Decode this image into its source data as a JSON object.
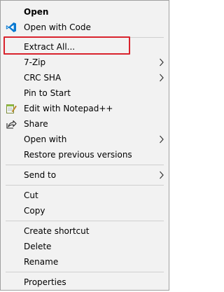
{
  "menu": {
    "items": [
      {
        "key": "open",
        "label": "Open",
        "bold": true
      },
      {
        "key": "open_code",
        "label": "Open with Code",
        "icon": "vscode-icon"
      },
      {
        "key": "extract",
        "label": "Extract All...",
        "highlighted": true
      },
      {
        "key": "zip",
        "label": "7-Zip",
        "submenu": true
      },
      {
        "key": "crc",
        "label": "CRC SHA",
        "submenu": true
      },
      {
        "key": "pin",
        "label": "Pin to Start"
      },
      {
        "key": "notepad",
        "label": "Edit with Notepad++",
        "icon": "notepad-plus-plus-icon"
      },
      {
        "key": "share",
        "label": "Share",
        "icon": "share-icon"
      },
      {
        "key": "open_with",
        "label": "Open with",
        "submenu": true
      },
      {
        "key": "restore",
        "label": "Restore previous versions"
      },
      {
        "key": "send_to",
        "label": "Send to",
        "submenu": true
      },
      {
        "key": "cut",
        "label": "Cut"
      },
      {
        "key": "copy",
        "label": "Copy"
      },
      {
        "key": "create_shortcut",
        "label": "Create shortcut"
      },
      {
        "key": "delete",
        "label": "Delete"
      },
      {
        "key": "rename",
        "label": "Rename"
      },
      {
        "key": "properties",
        "label": "Properties"
      }
    ]
  },
  "colors": {
    "menu_background": "#f2f2f2",
    "highlight_border": "#d9232d",
    "separator": "#cfcfcf",
    "vscode_blue": "#0a7ad1"
  }
}
